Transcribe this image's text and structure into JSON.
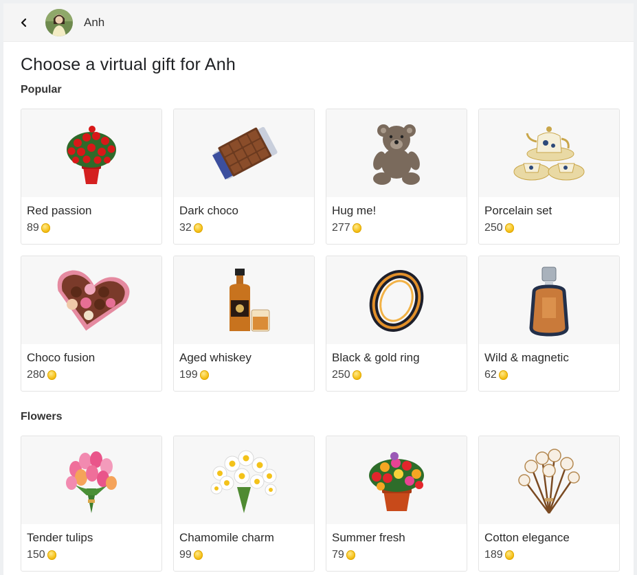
{
  "header": {
    "user_name": "Anh",
    "back_icon": "chevron-left-icon"
  },
  "page": {
    "title": "Choose a virtual gift for Anh"
  },
  "sections": {
    "popular": {
      "title": "Popular",
      "items": [
        {
          "name": "Red passion",
          "price": "89",
          "icon": "red-roses-pot"
        },
        {
          "name": "Dark choco",
          "price": "32",
          "icon": "chocolate-bar"
        },
        {
          "name": "Hug me!",
          "price": "277",
          "icon": "teddy-bear"
        },
        {
          "name": "Porcelain set",
          "price": "250",
          "icon": "tea-set"
        },
        {
          "name": "Choco fusion",
          "price": "280",
          "icon": "heart-chocolate-box"
        },
        {
          "name": "Aged whiskey",
          "price": "199",
          "icon": "whiskey-bottle"
        },
        {
          "name": "Black & gold ring",
          "price": "250",
          "icon": "ring"
        },
        {
          "name": "Wild & magnetic",
          "price": "62",
          "icon": "perfume-bottle"
        }
      ]
    },
    "flowers": {
      "title": "Flowers",
      "items": [
        {
          "name": "Tender tulips",
          "price": "150",
          "icon": "tulip-bouquet"
        },
        {
          "name": "Chamomile charm",
          "price": "99",
          "icon": "chamomile-bouquet"
        },
        {
          "name": "Summer fresh",
          "price": "79",
          "icon": "flower-pot"
        },
        {
          "name": "Cotton elegance",
          "price": "189",
          "icon": "cotton-bouquet"
        }
      ]
    }
  },
  "colors": {
    "coin": "#f6c21c",
    "card_border": "#e4e4e4",
    "image_bg": "#f7f7f7",
    "header_bg": "#f5f5f5"
  }
}
